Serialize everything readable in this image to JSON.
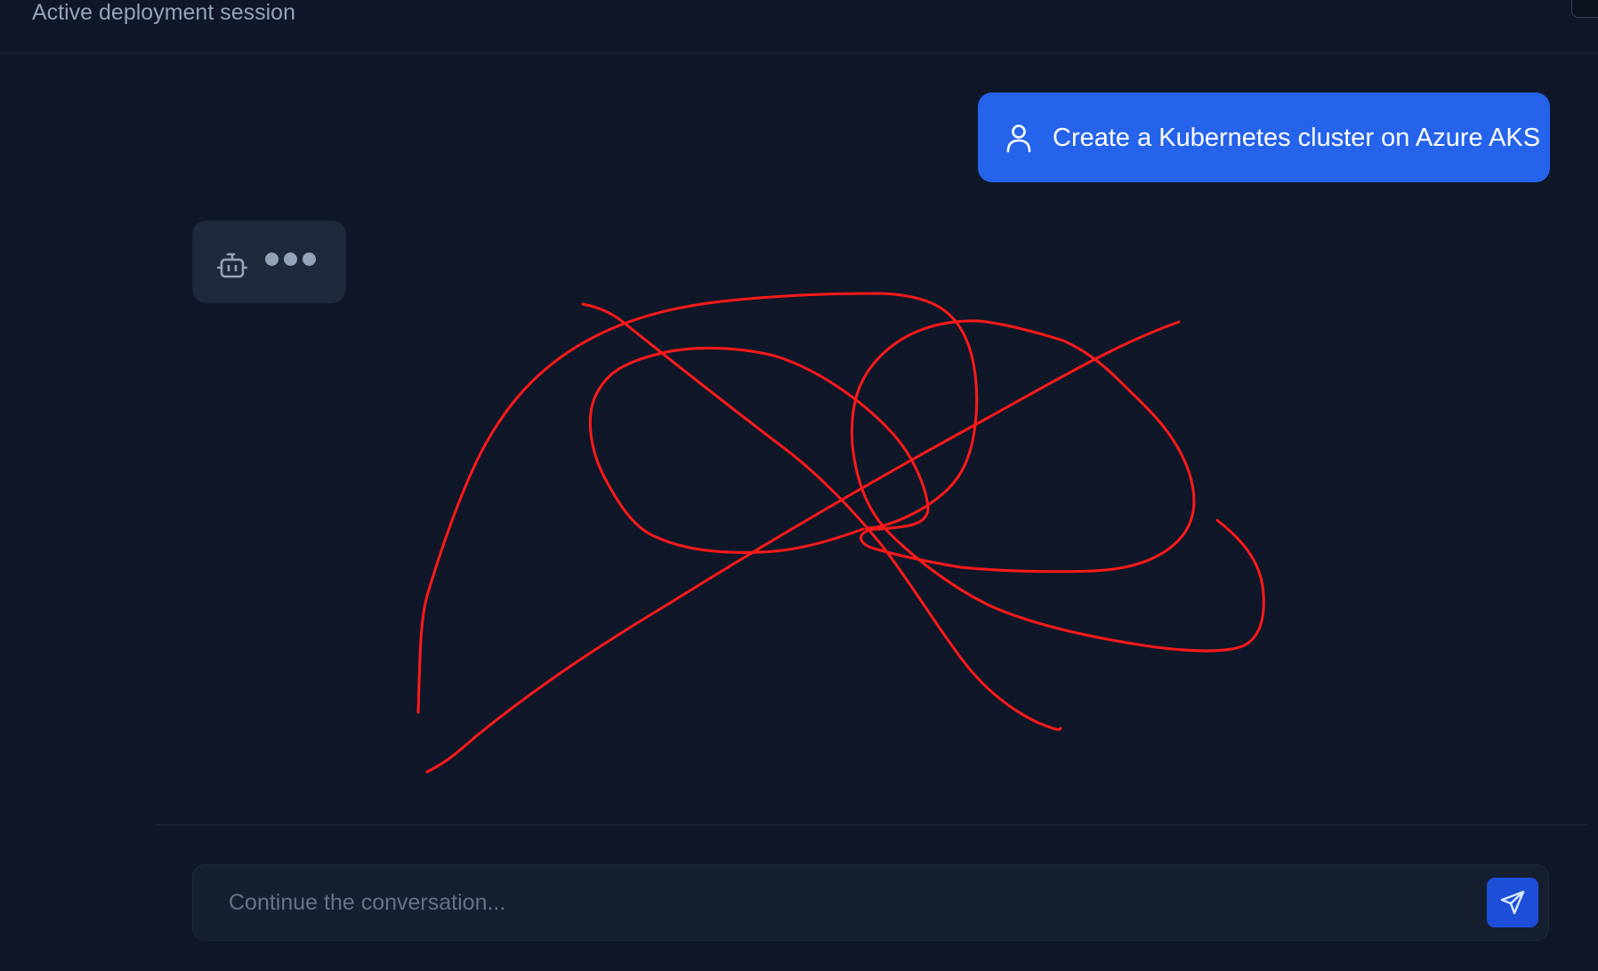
{
  "header": {
    "subtitle": "Active deployment session"
  },
  "messages": [
    {
      "role": "user",
      "icon": "user-icon",
      "text": "Create a Kubernetes cluster on Azure AKS"
    },
    {
      "role": "assistant",
      "icon": "robot-icon",
      "state": "typing"
    }
  ],
  "composer": {
    "value": "",
    "placeholder": "Continue the conversation...",
    "send_icon": "send-icon"
  },
  "colors": {
    "background": "#0f1729",
    "user_bubble": "#2563eb",
    "assistant_bubble": "#1e293b",
    "send_button": "#1d4ed8",
    "annotation": "#ff0000"
  }
}
